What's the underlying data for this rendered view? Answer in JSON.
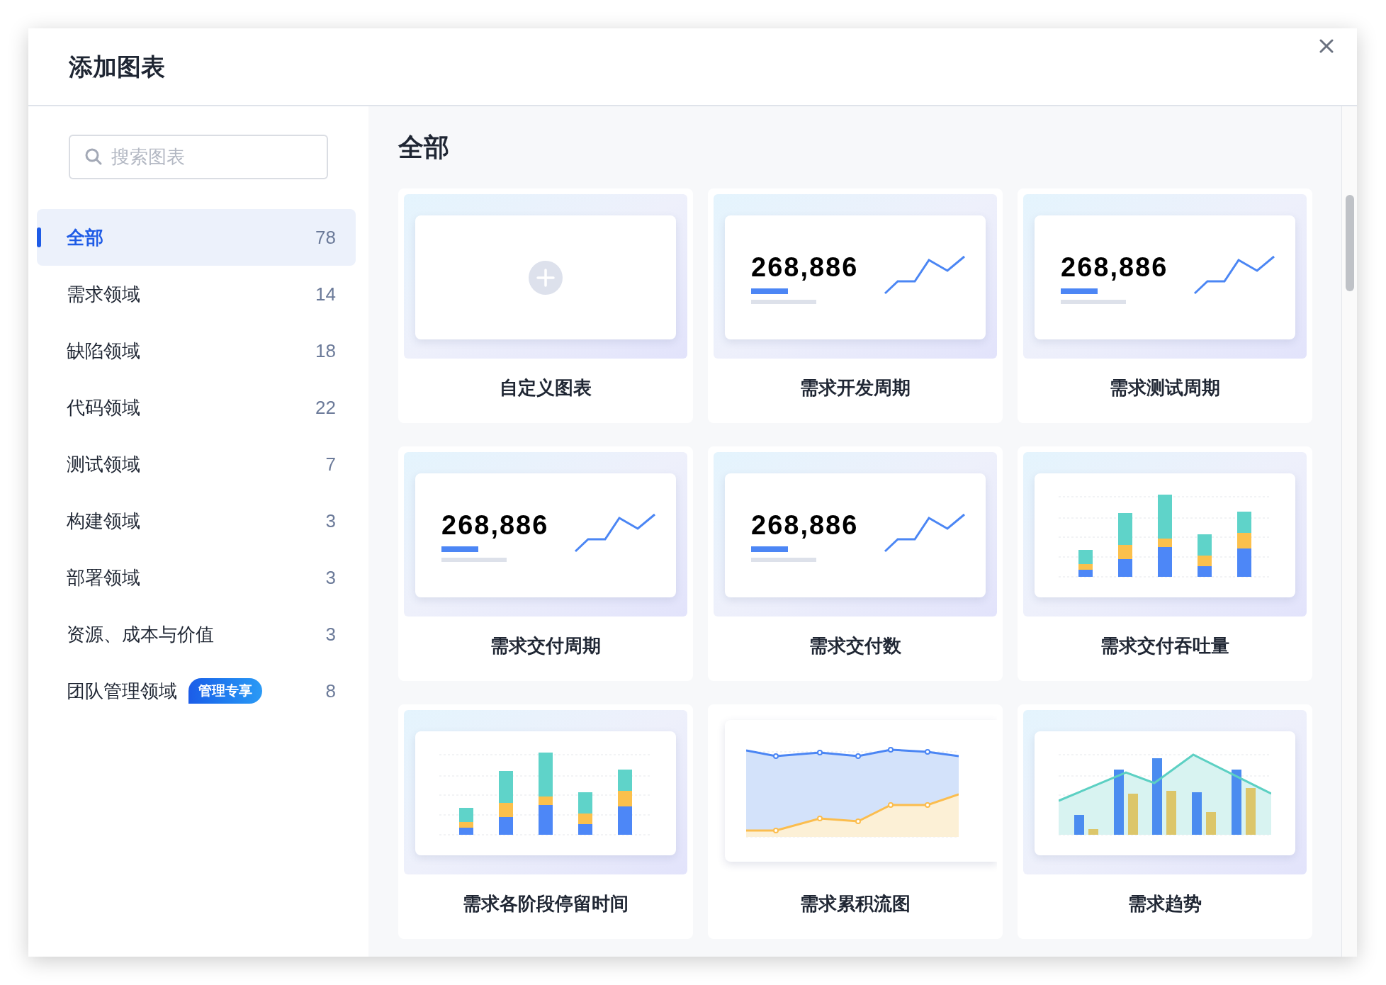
{
  "dialog": {
    "title": "添加图表"
  },
  "search": {
    "placeholder": "搜索图表"
  },
  "categories": [
    {
      "label": "全部",
      "count": "78",
      "selected": true
    },
    {
      "label": "需求领域",
      "count": "14",
      "selected": false
    },
    {
      "label": "缺陷领域",
      "count": "18",
      "selected": false
    },
    {
      "label": "代码领域",
      "count": "22",
      "selected": false
    },
    {
      "label": "测试领域",
      "count": "7",
      "selected": false
    },
    {
      "label": "构建领域",
      "count": "3",
      "selected": false
    },
    {
      "label": "部署领域",
      "count": "3",
      "selected": false
    },
    {
      "label": "资源、成本与价值",
      "count": "3",
      "selected": false
    },
    {
      "label": "团队管理领域",
      "badge": "管理专享",
      "count": "8",
      "selected": false
    }
  ],
  "section_title": "全部",
  "charts": [
    {
      "kind": "add",
      "label": "自定义图表"
    },
    {
      "kind": "metric",
      "value": "268,886",
      "label": "需求开发周期"
    },
    {
      "kind": "metric",
      "value": "268,886",
      "label": "需求测试周期"
    },
    {
      "kind": "metric",
      "value": "268,886",
      "label": "需求交付周期"
    },
    {
      "kind": "metric",
      "value": "268,886",
      "label": "需求交付数"
    },
    {
      "kind": "bar",
      "label": "需求交付吞吐量"
    },
    {
      "kind": "bar",
      "label": "需求各阶段停留时间"
    },
    {
      "kind": "area",
      "label": "需求累积流图"
    },
    {
      "kind": "combo",
      "label": "需求趋势"
    }
  ]
}
